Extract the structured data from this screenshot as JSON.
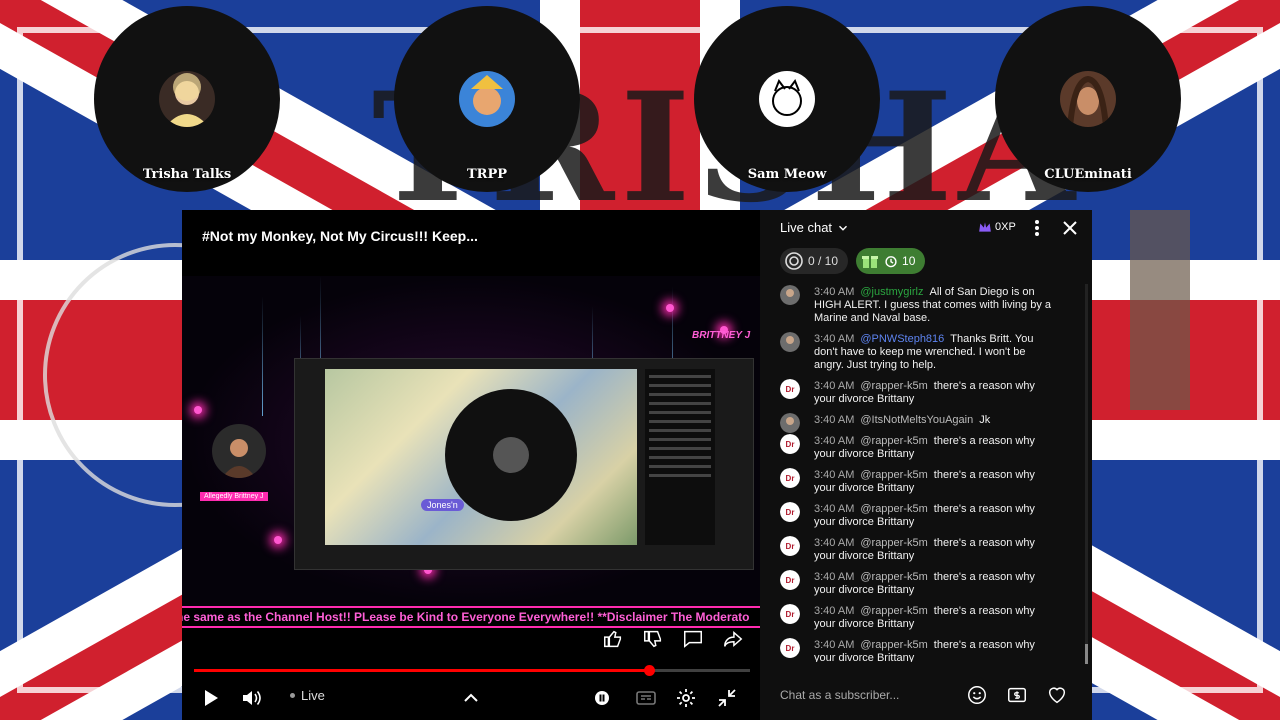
{
  "participants": [
    {
      "name": "Trisha Talks"
    },
    {
      "name": "TRPP"
    },
    {
      "name": "Sam Meow"
    },
    {
      "name": "CLUEminati"
    }
  ],
  "background": {
    "deco_text": "TRISHA"
  },
  "player": {
    "title": "#Not my Monkey, Not My Circus!!!  Keep...",
    "brand": "BRITTNEY J",
    "inner_tag": "Jones'n",
    "side_guest_tag": "Allegedly Brittney J",
    "ticker": "he same as the Channel Host!! PLease be Kind to Everyone Everywhere!! **Disclaimer The Moderato",
    "live_label": "Live",
    "progress_fraction": 0.82
  },
  "chat": {
    "title": "Live chat",
    "xp_label": "0XP",
    "goal_pill": "0 / 10",
    "gift_pill": "10",
    "messages": [
      {
        "time": "3:40 AM",
        "author": "@justmygirlz",
        "author_color": "green",
        "text": "All of San Diego is on HIGH ALERT. I guess that comes with living by a Marine and Naval base."
      },
      {
        "time": "3:40 AM",
        "author": "@PNWSteph816",
        "author_color": "blue",
        "text": "Thanks Britt. You don't have to keep me wrenched. I won't be angry. Just trying to help."
      },
      {
        "time": "3:40 AM",
        "author": "@rapper-k5m",
        "author_color": "gray",
        "text": "there's a reason why your divorce Brittany"
      },
      {
        "time": "3:40 AM",
        "author": "@ItsNotMeltsYouAgain",
        "author_color": "gray",
        "text": "Jk"
      },
      {
        "time": "3:40 AM",
        "author": "@rapper-k5m",
        "author_color": "gray",
        "text": "there's a reason why your divorce Brittany"
      },
      {
        "time": "3:40 AM",
        "author": "@rapper-k5m",
        "author_color": "gray",
        "text": "there's a reason why your divorce Brittany"
      },
      {
        "time": "3:40 AM",
        "author": "@rapper-k5m",
        "author_color": "gray",
        "text": "there's a reason why your divorce Brittany"
      },
      {
        "time": "3:40 AM",
        "author": "@rapper-k5m",
        "author_color": "gray",
        "text": "there's a reason why your divorce Brittany"
      },
      {
        "time": "3:40 AM",
        "author": "@rapper-k5m",
        "author_color": "gray",
        "text": "there's a reason why your divorce Brittany"
      },
      {
        "time": "3:40 AM",
        "author": "@rapper-k5m",
        "author_color": "gray",
        "text": "there's a reason why your divorce Brittany"
      },
      {
        "time": "3:40 AM",
        "author": "@rapper-k5m",
        "author_color": "gray",
        "text": "there's a reason why your divorce Brittany"
      }
    ],
    "input_placeholder": "Chat as a subscriber..."
  },
  "colors": {
    "accent_pink": "#ff2bb0",
    "progress_red": "#ff0000",
    "chat_bg": "#0f0f0f"
  }
}
